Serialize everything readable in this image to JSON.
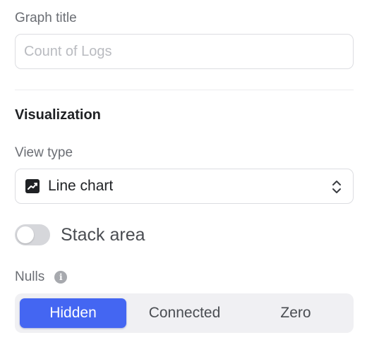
{
  "graph_title": {
    "label": "Graph title",
    "placeholder": "Count of Logs",
    "value": ""
  },
  "visualization": {
    "heading": "Visualization",
    "view_type": {
      "label": "View type",
      "selected": "Line chart",
      "icon": "line-chart-icon"
    },
    "stack_area": {
      "label": "Stack area",
      "enabled": false
    },
    "nulls": {
      "label": "Nulls",
      "info_icon": "info-icon",
      "options": [
        "Hidden",
        "Connected",
        "Zero"
      ],
      "selected": "Hidden"
    }
  },
  "colors": {
    "accent": "#4466f2",
    "toggle_off": "#d6d7db",
    "segment_bg": "#f0f0f3"
  }
}
